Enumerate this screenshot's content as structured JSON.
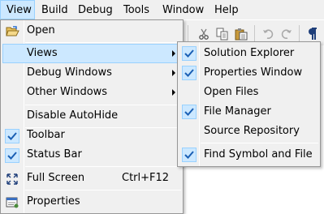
{
  "menubar": {
    "items": [
      "View",
      "Build",
      "Debug",
      "Tools",
      "Window",
      "Help"
    ]
  },
  "view_menu": {
    "items": [
      {
        "label": "Open",
        "icon": "open-folder-icon"
      },
      {
        "label": "Views",
        "has_submenu": true,
        "highlighted": true
      },
      {
        "label": "Debug Windows",
        "has_submenu": true
      },
      {
        "label": "Other Windows",
        "has_submenu": true
      },
      {
        "label": "Disable AutoHide"
      },
      {
        "label": "Toolbar",
        "checked": true
      },
      {
        "label": "Status Bar",
        "checked": true
      },
      {
        "label": "Full Screen",
        "shortcut": "Ctrl+F12",
        "icon": "full-screen-icon"
      },
      {
        "label": "Properties",
        "icon": "properties-icon"
      }
    ]
  },
  "views_submenu": {
    "items": [
      {
        "label": "Solution Explorer",
        "checked": true
      },
      {
        "label": "Properties Window",
        "checked": true
      },
      {
        "label": "Open Files",
        "checked": false
      },
      {
        "label": "File Manager",
        "checked": true
      },
      {
        "label": "Source Repository",
        "checked": false
      },
      {
        "label": "Find Symbol and File",
        "checked": true
      }
    ]
  },
  "colors": {
    "highlight_bg": "#cce8ff",
    "highlight_border": "#99d1ff",
    "menu_bg": "#f0f0f0",
    "check_mark": "#1a5fb4"
  }
}
